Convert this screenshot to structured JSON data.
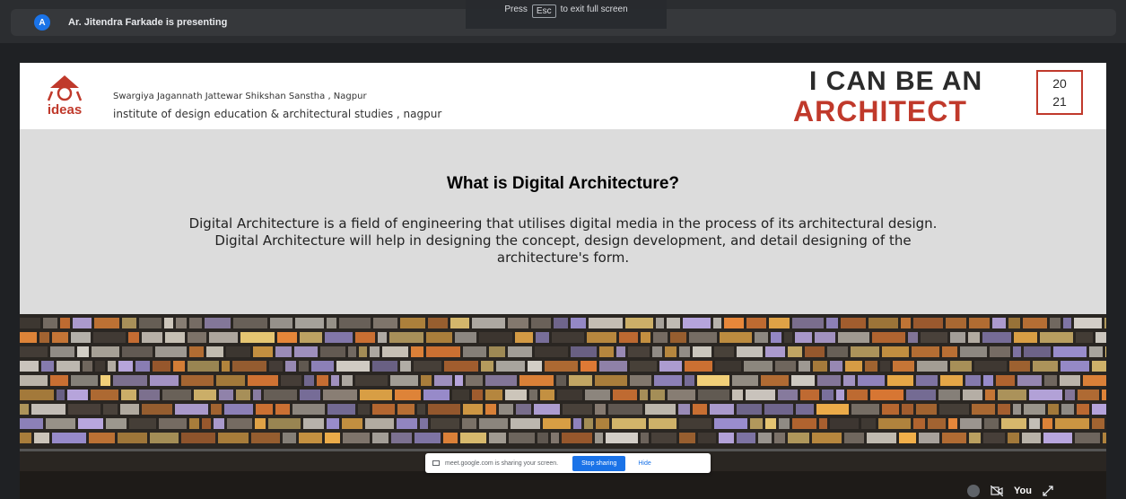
{
  "presenter": {
    "avatar_letter": "A",
    "text": "Ar. Jitendra Farkade is presenting"
  },
  "fullscreen_hint": {
    "prefix": "Press",
    "key": "Esc",
    "suffix": "to exit full screen"
  },
  "slide": {
    "logo_text": "ideas",
    "org_line1": "Swargiya Jagannath Jattewar Shikshan Sanstha , Nagpur",
    "org_line2": "institute of design education & architectural studies , nagpur",
    "brand_line1": "I CAN BE AN",
    "brand_line2": "ARCHITECT",
    "year_line1": "20",
    "year_line2": "21",
    "heading": "What is Digital Architecture?",
    "body_line1": "Digital Architecture is a field of engineering that utilises digital media in the process of its architectural design.",
    "body_line2": "Digital Architecture will help in designing the concept, design development, and detail designing of the",
    "body_line3": "architecture's form."
  },
  "share_bar": {
    "message": "meet.google.com is sharing your screen.",
    "stop_label": "Stop sharing",
    "hide_label": "Hide"
  },
  "self_tile": {
    "label": "You"
  },
  "colors": {
    "brand_red": "#c0392b",
    "meet_blue": "#1a73e8"
  }
}
